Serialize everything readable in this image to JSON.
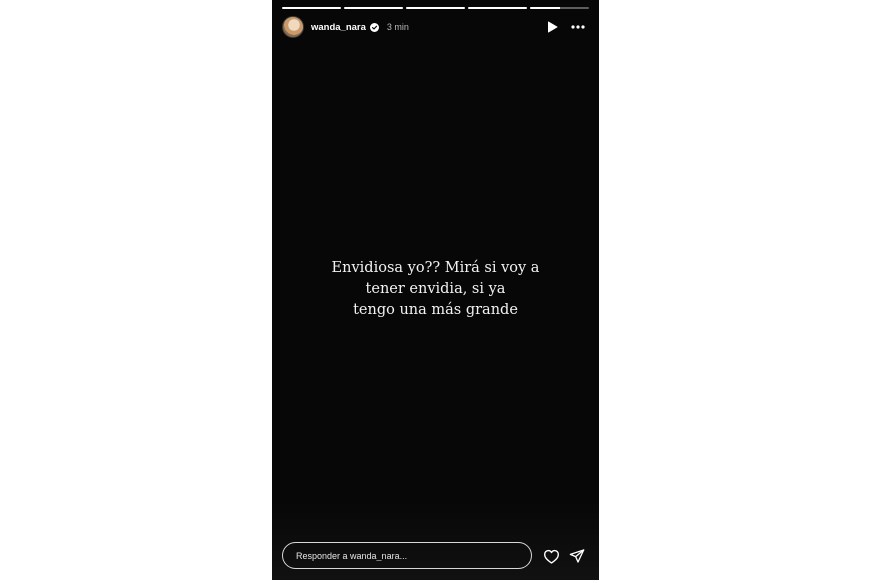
{
  "story": {
    "segments_total": 5,
    "segments_progress": [
      1,
      1,
      1,
      1,
      0.5
    ],
    "user": {
      "username": "wanda_nara",
      "verified": true,
      "time": "3 min"
    },
    "controls": {
      "play_icon": "play-icon",
      "more_icon": "more-horizontal-icon"
    },
    "caption_lines": [
      "Envidiosa yo?? Mirá si voy a",
      "tener envidia, si ya",
      "tengo una más grande"
    ],
    "reply": {
      "placeholder": "Responder a wanda_nara...",
      "like_icon": "heart-icon",
      "share_icon": "send-icon"
    }
  },
  "colors": {
    "background": "#070707",
    "text": "#f2f2f2",
    "muted": "#b8b8b8",
    "verified": "#ffffff"
  }
}
